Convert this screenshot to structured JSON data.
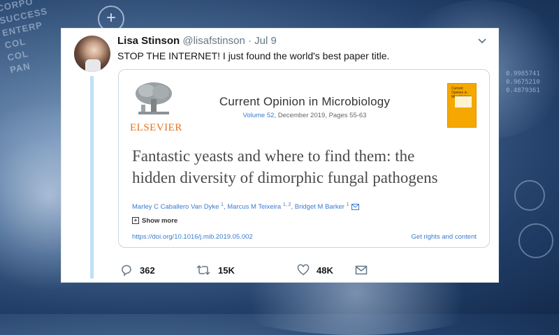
{
  "background": {
    "words": [
      "CORPO",
      "SUCCESS",
      "ENTERP",
      "COL",
      "COL",
      "PAN"
    ],
    "hex_values": [
      "0.9985741",
      "0.9675210",
      "0.4879361"
    ]
  },
  "tweet": {
    "author_name": "Lisa Stinson",
    "handle": "@lisafstinson",
    "separator": "·",
    "date": "Jul 9",
    "text": "STOP THE INTERNET! I just found the world's best paper title."
  },
  "card": {
    "publisher": "ELSEVIER",
    "journal_title": "Current Opinion in Microbiology",
    "volume": "Volume 52",
    "issue_details": ", December 2019, Pages 55-63",
    "cover_label": "Current Opinion in Microbiology",
    "paper_title_line1": "Fantastic yeasts and where to find them: the",
    "paper_title_line2": "hidden diversity of dimorphic fungal pathogens",
    "author1": "Marley C Caballero Van Dyke",
    "author1_sup": "1",
    "author2": "Marcus M Teixeira",
    "author2_sup": "1, 2",
    "author3": "Bridget M Barker",
    "author3_sup": "1",
    "author_sep": ", ",
    "show_more_plus": "+",
    "show_more": "Show more",
    "doi": "https://doi.org/10.1016/j.mib.2019.05.002",
    "rights": "Get rights and content"
  },
  "actions": {
    "replies": "362",
    "retweets": "15K",
    "likes": "48K"
  },
  "colors": {
    "link": "#3a7ad0",
    "elsevier_orange": "#e9711c",
    "thread_line": "#bfe0f5"
  }
}
